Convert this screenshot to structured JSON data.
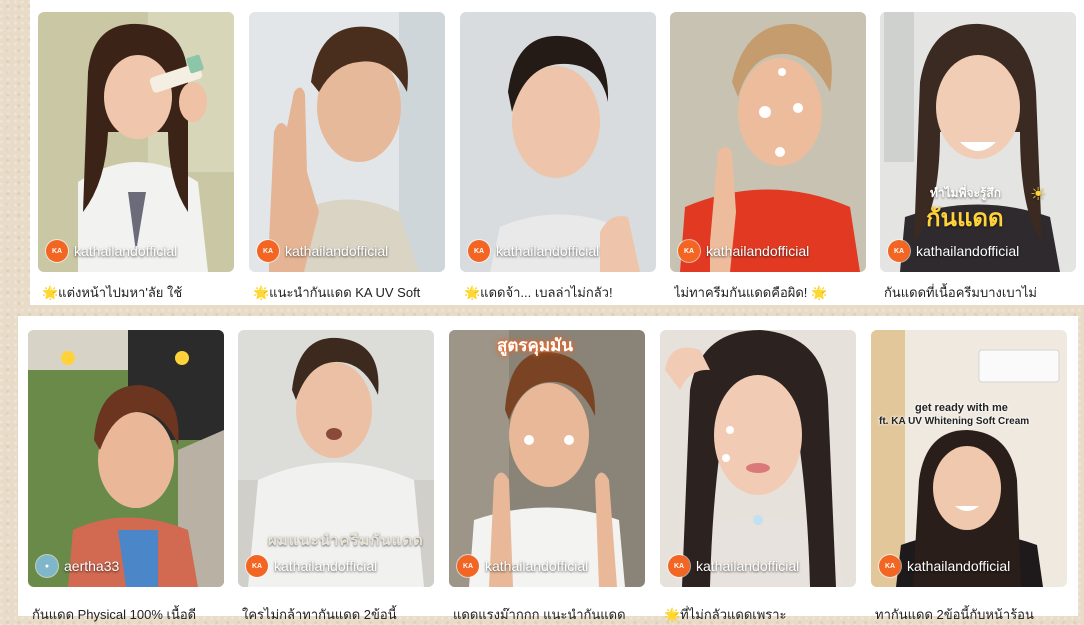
{
  "row1": [
    {
      "account": "kathailandofficial",
      "caption": "🌟แต่งหน้าไปมหา'ลัย ใช้"
    },
    {
      "account": "kathailandofficial",
      "caption": "🌟แนะนำกันแดด KA UV Soft"
    },
    {
      "account": "kathailandofficial",
      "caption": "🌟แดดจ้า... เบลล่าไม่กลัว!"
    },
    {
      "account": "kathailandofficial",
      "caption": "ไม่ทาครีมกันแดดคือผิด! 🌟"
    },
    {
      "account": "kathailandofficial",
      "caption": "กันแดดที่เนื้อครีมบางเบาไม่",
      "overlay_small": "ทำไมพี่จะรู้สึก",
      "overlay_big": "กันแดด"
    }
  ],
  "row2": [
    {
      "account": "aertha33",
      "caption": "กันแดด Physical 100% เนื้อดี"
    },
    {
      "account": "kathailandofficial",
      "caption": "ใครไม่กล้าทากันแดด 2ข้อนี้",
      "overlay": "ผมแนะนำครีมกันแดด"
    },
    {
      "account": "kathailandofficial",
      "caption": "แดดแรงม๊ากกก แนะนำกันแดด",
      "overlay_top": "สูตรคุมมัน"
    },
    {
      "account": "kathailandofficial",
      "caption": "🌟ที่ไม่กลัวแดดเพราะ"
    },
    {
      "account": "kathailandofficial",
      "caption": "ทากันแดด 2ข้อนี้กับหน้าร้อน",
      "overlay_line1": "get ready with me",
      "overlay_line2": "ft. KA UV Whitening Soft Cream"
    }
  ],
  "avatar_brand_text": "KA",
  "colors": {
    "brand": "#f26522",
    "background": "#e8dcc8"
  }
}
